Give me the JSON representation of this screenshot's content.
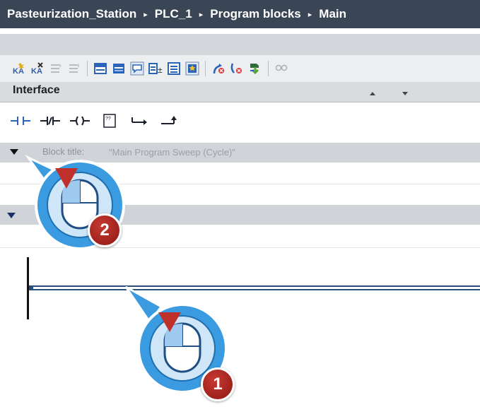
{
  "breadcrumb": {
    "items": [
      "Pasteurization_Station",
      "PLC_1",
      "Program blocks",
      "Main"
    ],
    "separator": "▸"
  },
  "toolbar": {
    "icons": [
      "insert-row-icon",
      "delete-row-icon",
      "indent-icon",
      "outdent-icon",
      "network-collapse-icon",
      "network-expand-icon",
      "comment-icon",
      "absolute-operands-icon",
      "expand-all-icon",
      "favorites-icon",
      "go-to-error-icon",
      "monitor-off-icon",
      "download-icon",
      "glasses-icon"
    ]
  },
  "interface": {
    "label": "Interface"
  },
  "ladder_elements": {
    "icons": [
      "normally-open-contact-icon",
      "normally-closed-contact-icon",
      "coil-icon",
      "empty-box-icon",
      "open-branch-icon",
      "close-branch-icon"
    ],
    "empty_box_text": "??"
  },
  "block": {
    "name": "Block title:",
    "comment": "\"Main Program Sweep (Cycle)\""
  },
  "callouts": {
    "step1": "1",
    "step2": "2"
  },
  "colors": {
    "titlebar": "#3a4556",
    "badge": "#a8231c",
    "callout_blue": "#3b9be0",
    "rung": "#2a4f7a"
  }
}
